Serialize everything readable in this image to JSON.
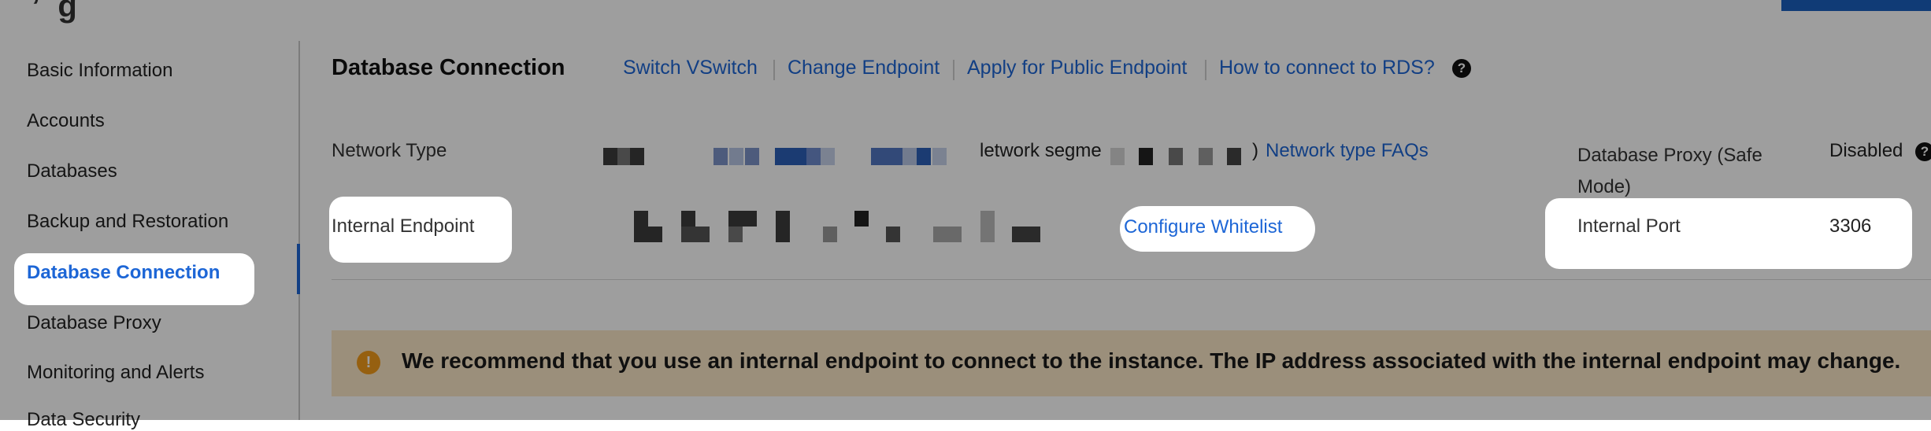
{
  "sidebar": {
    "items": [
      {
        "label": "Basic Information"
      },
      {
        "label": "Accounts"
      },
      {
        "label": "Databases"
      },
      {
        "label": "Backup and Restoration"
      },
      {
        "label": "Database Connection",
        "active": true
      },
      {
        "label": "Database Proxy"
      },
      {
        "label": "Monitoring and Alerts"
      },
      {
        "label": "Data Security"
      }
    ]
  },
  "header": {
    "title": "Database Connection",
    "links": [
      "Switch VSwitch",
      "Change Endpoint",
      "Apply for Public Endpoint",
      "How to connect to RDS?"
    ],
    "help_icon": "question-circle-icon"
  },
  "network": {
    "label": "Network Type",
    "partial_text": "letwork segme",
    "close_paren": ")",
    "faq_link": "Network type FAQs",
    "proxy_label": "Database Proxy (Safe Mode)",
    "proxy_value": "Disabled",
    "proxy_help_icon": "question-circle-icon"
  },
  "endpoint": {
    "label": "Internal Endpoint",
    "configure_link": "Configure Whitelist",
    "port_label": "Internal Port",
    "port_value": "3306"
  },
  "alert": {
    "icon": "warning-circle-icon",
    "text": "We recommend that you use an internal endpoint to connect to the instance. The IP address associated with the internal endpoint may change."
  },
  "colors": {
    "link": "#1d66d6",
    "alert_bg": "#fbe7c7",
    "alert_icon": "#f39b1b"
  }
}
